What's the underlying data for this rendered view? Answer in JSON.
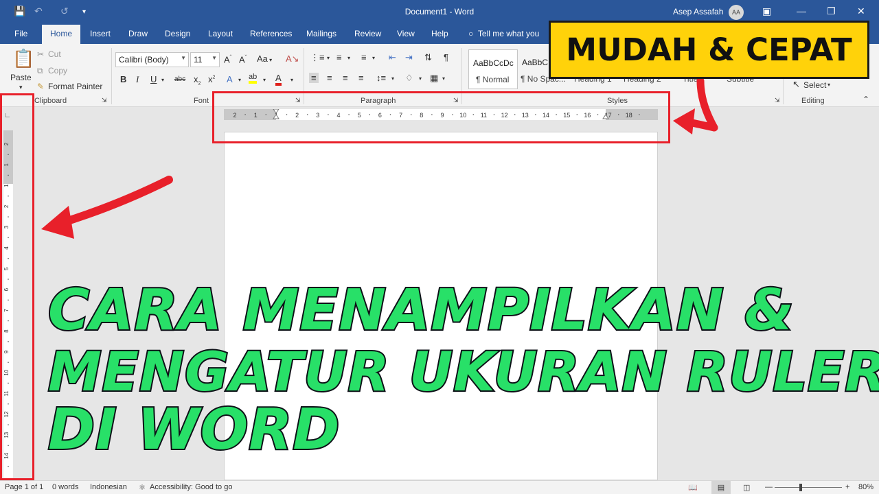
{
  "app": {
    "title": "Document1  -  Word",
    "user_name": "Asep Assafah",
    "user_initials": "AA"
  },
  "quick_access": {
    "save_icon": "save-icon",
    "undo_icon": "undo-icon",
    "redo_icon": "redo-icon",
    "customize_icon": "customize-icon"
  },
  "tabs": [
    "File",
    "Home",
    "Insert",
    "Draw",
    "Design",
    "Layout",
    "References",
    "Mailings",
    "Review",
    "View",
    "Help"
  ],
  "active_tab": "Home",
  "tell_me": "Tell me what you",
  "clipboard": {
    "paste": "Paste",
    "cut": "Cut",
    "copy": "Copy",
    "format_painter": "Format Painter",
    "group_label": "Clipboard"
  },
  "font": {
    "family": "Calibri (Body)",
    "size": "11",
    "case_label": "Aa",
    "group_label": "Font"
  },
  "paragraph": {
    "group_label": "Paragraph"
  },
  "styles": {
    "group_label": "Styles",
    "items": [
      {
        "preview": "AaBbCcDc",
        "name": "¶ Normal"
      },
      {
        "preview": "AaBbC",
        "name": "¶ No Spac..."
      },
      {
        "preview": "",
        "name": "Heading 1"
      },
      {
        "preview": "",
        "name": "Heading 2"
      },
      {
        "preview": "",
        "name": "Title"
      },
      {
        "preview": "",
        "name": "Subtitle"
      }
    ]
  },
  "editing": {
    "select": "Select",
    "group_label": "Editing"
  },
  "ruler": {
    "horizontal_ticks": [
      "2",
      "1",
      "1",
      "2",
      "3",
      "4",
      "5",
      "6",
      "7",
      "8",
      "9",
      "10",
      "11",
      "12",
      "13",
      "14",
      "15",
      "16",
      "17",
      "18"
    ],
    "vertical_ticks": [
      "2",
      "1",
      "1",
      "2",
      "3",
      "4",
      "5",
      "6",
      "7",
      "8",
      "9",
      "10",
      "11",
      "12",
      "13",
      "14"
    ]
  },
  "overlay": {
    "badge": "MUDAH & CEPAT",
    "headline_line1": "CARA MENAMPILKAN &",
    "headline_line2": "MENGATUR UKURAN RULER",
    "headline_line3": "DI WORD",
    "accent_red": "#e8202a",
    "headline_green": "#28e068",
    "badge_yellow": "#ffd20a"
  },
  "status": {
    "page": "Page 1 of 1",
    "words": "0 words",
    "language": "Indonesian",
    "accessibility": "Accessibility: Good to go",
    "zoom": "80%"
  },
  "colors": {
    "word_blue": "#2b579a",
    "ribbon_bg": "#f3f3f3"
  }
}
